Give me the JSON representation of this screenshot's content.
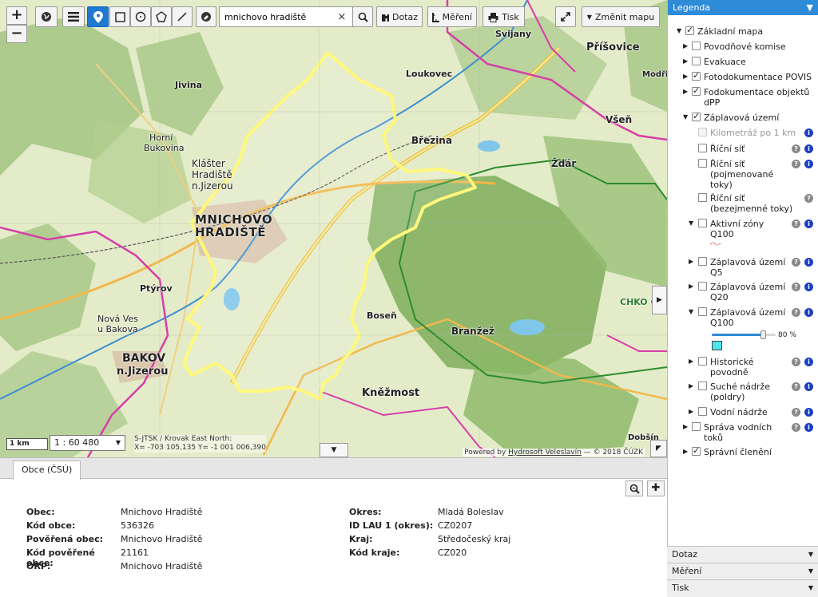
{
  "toolbar": {
    "zoom_in": "+",
    "zoom_out": "−",
    "search_value": "mnichovo hradiště",
    "clear": "×",
    "query_label": "Dotaz",
    "measure_label": "Měření",
    "print_label": "Tisk",
    "change_map_label": "Změnit mapu"
  },
  "map": {
    "scale_bar": "1 km",
    "scale": "1 : 60 480",
    "coords_line1": "S-JTSK / Krovak East North:",
    "coords_line2": "X= -703 105,135 Y= -1 001 006,390",
    "attribution_prefix": "Powered by",
    "attribution_link": "Hydrosoft Veleslavín",
    "attribution_suffix": "— © 2018 ČÚZK",
    "labels": {
      "mnichovo": "MNICHOVO",
      "hradiste": "HRADIŠTĚ",
      "bakov": "BAKOV",
      "njizerou": "n.Jizerou",
      "klaster": "Klášter",
      "klaster2": "Hradiště",
      "klaster3": "n.Jizerou",
      "kneznost": "Kněžmost",
      "branzez": "Branžež",
      "bosen": "Boseň",
      "brezina": "Březina",
      "loukovec": "Loukovec",
      "prisovice": "Příšovice",
      "zdar": "Žďár",
      "vsen": "Všeň",
      "jivina": "Jivina",
      "horni_bukovina": "Horní",
      "horni_bukovina2": "Bukovina",
      "ptyrov": "Ptýrov",
      "nova_ves": "Nová Ves",
      "u_bakova": "u Bakova",
      "sviany": "Svijany",
      "chko": "CHKO Če",
      "dobsin": "Dobšín",
      "modris": "Modřiš"
    }
  },
  "panel": {
    "tab_label": "Obce (ČSÚ)",
    "left": [
      {
        "k": "Obec:",
        "v": "Mnichovo Hradiště"
      },
      {
        "k": "Kód obce:",
        "v": "536326"
      },
      {
        "k": "Pověřená obec:",
        "v": "Mnichovo Hradiště"
      },
      {
        "k": "Kód pověřené obce:",
        "v": "21161"
      },
      {
        "k": "ORP:",
        "v": "Mnichovo Hradiště"
      }
    ],
    "right": [
      {
        "k": "Okres:",
        "v": "Mladá Boleslav"
      },
      {
        "k": "ID LAU 1 (okres):",
        "v": "CZ0207"
      },
      {
        "k": "Kraj:",
        "v": "Středočeský kraj"
      },
      {
        "k": "Kód kraje:",
        "v": "CZ020"
      }
    ]
  },
  "legend": {
    "title": "Legenda",
    "items": {
      "zakladni": "Základní mapa",
      "povodnove": "Povodňové komise",
      "evakuace": "Evakuace",
      "fotodok": "Fotodokumentace POVIS",
      "fodok1": "Fodokumentace objektů",
      "fodok2": "dPP",
      "zaplavova": "Záplavová území",
      "kilometraz": "Kilometráž po 1 km",
      "ricni": "Říční síť",
      "ricni_pojm1": "Říční síť",
      "ricni_pojm2": "(pojmenované",
      "ricni_pojm3": "toky)",
      "ricni_bez1": "Říční síť",
      "ricni_bez2": "(bezejmenné toky)",
      "aktivni1": "Aktivní zóny",
      "aktivni2": "Q100",
      "q5_1": "Záplavová území",
      "q5_2": "Q5",
      "q20_1": "Záplavová území",
      "q20_2": "Q20",
      "q100_1": "Záplavová území",
      "q100_2": "Q100",
      "opacity": "80 %",
      "historicke1": "Historické",
      "historicke2": "povodně",
      "suche1": "Suché nádrže",
      "suche2": "(poldry)",
      "vodni": "Vodní nádrže",
      "sprava1": "Správa vodních",
      "sprava2": "toků",
      "spravni": "Správní členění"
    },
    "opacity_level": 0.8,
    "swatch_color": "#4fe3f0",
    "accordion": [
      "Dotaz",
      "Měření",
      "Tisk"
    ]
  },
  "colors": {
    "accent": "#2e8bd8",
    "boundary": "#ffff66",
    "pink_boundary": "#d63ea8",
    "forest": "#7fae5c"
  }
}
